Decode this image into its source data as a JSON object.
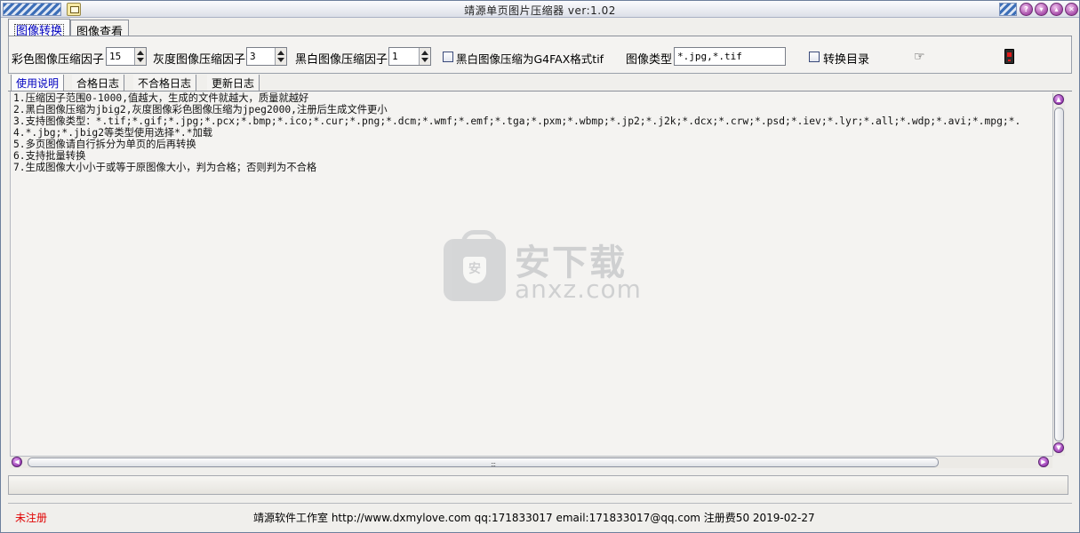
{
  "window": {
    "title": "靖源单页图片压缩器 ver:1.02"
  },
  "tabs": [
    {
      "label": "图像转换",
      "active": true
    },
    {
      "label": "图像查看",
      "active": false
    }
  ],
  "settings": {
    "color_factor_label": "彩色图像压缩因子",
    "color_factor_value": "15",
    "gray_factor_label": "灰度图像压缩因子",
    "gray_factor_value": "3",
    "bw_factor_label": "黑白图像压缩因子",
    "bw_factor_value": "1",
    "g4fax_label": "黑白图像压缩为G4FAX格式tif",
    "g4fax_checked": false,
    "image_type_label": "图像类型",
    "image_type_value": "*.jpg,*.tif",
    "convert_dir_label": "转换目录",
    "convert_dir_checked": false
  },
  "subtabs": [
    {
      "label": "使用说明",
      "active": true
    },
    {
      "label": "合格日志",
      "active": false
    },
    {
      "label": "不合格日志",
      "active": false
    },
    {
      "label": "更新日志",
      "active": false
    }
  ],
  "instructions": [
    "1.压缩因子范围0-1000,值越大，生成的文件就越大，质量就越好",
    "2.黑白图像压缩为jbig2,灰度图像彩色图像压缩为jpeg2000,注册后生成文件更小",
    "3.支持图像类型：*.tif;*.gif;*.jpg;*.pcx;*.bmp;*.ico;*.cur;*.png;*.dcm;*.wmf;*.emf;*.tga;*.pxm;*.wbmp;*.jp2;*.j2k;*.dcx;*.crw;*.psd;*.iev;*.lyr;*.all;*.wdp;*.avi;*.mpg;*.",
    "4.*.jbg;*.jbig2等类型使用选择*.*加载",
    "5.多页图像请自行拆分为单页的后再转换",
    "6.支持批量转换",
    "7.生成图像大小小于或等于原图像大小，判为合格；否则判为不合格"
  ],
  "watermark": {
    "cn": "安下载",
    "en": "anxz.com",
    "shield_char": "安"
  },
  "status": {
    "registration": "未注册",
    "info": "靖源软件工作室 http://www.dxmylove.com qq:171833017 email:171833017@qq.com 注册费50 2019-02-27"
  },
  "colors": {
    "active_tab_text": "#0000c0",
    "unregistered_text": "#e00000"
  }
}
